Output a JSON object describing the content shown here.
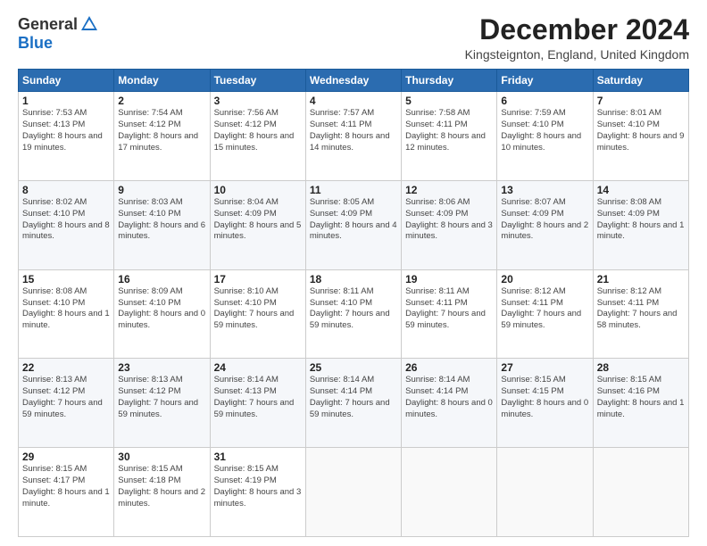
{
  "header": {
    "logo_general": "General",
    "logo_blue": "Blue",
    "title": "December 2024",
    "location": "Kingsteignton, England, United Kingdom"
  },
  "days_of_week": [
    "Sunday",
    "Monday",
    "Tuesday",
    "Wednesday",
    "Thursday",
    "Friday",
    "Saturday"
  ],
  "weeks": [
    [
      {
        "day": "1",
        "sunrise": "7:53 AM",
        "sunset": "4:13 PM",
        "daylight": "8 hours and 19 minutes."
      },
      {
        "day": "2",
        "sunrise": "7:54 AM",
        "sunset": "4:12 PM",
        "daylight": "8 hours and 17 minutes."
      },
      {
        "day": "3",
        "sunrise": "7:56 AM",
        "sunset": "4:12 PM",
        "daylight": "8 hours and 15 minutes."
      },
      {
        "day": "4",
        "sunrise": "7:57 AM",
        "sunset": "4:11 PM",
        "daylight": "8 hours and 14 minutes."
      },
      {
        "day": "5",
        "sunrise": "7:58 AM",
        "sunset": "4:11 PM",
        "daylight": "8 hours and 12 minutes."
      },
      {
        "day": "6",
        "sunrise": "7:59 AM",
        "sunset": "4:10 PM",
        "daylight": "8 hours and 10 minutes."
      },
      {
        "day": "7",
        "sunrise": "8:01 AM",
        "sunset": "4:10 PM",
        "daylight": "8 hours and 9 minutes."
      }
    ],
    [
      {
        "day": "8",
        "sunrise": "8:02 AM",
        "sunset": "4:10 PM",
        "daylight": "8 hours and 8 minutes."
      },
      {
        "day": "9",
        "sunrise": "8:03 AM",
        "sunset": "4:10 PM",
        "daylight": "8 hours and 6 minutes."
      },
      {
        "day": "10",
        "sunrise": "8:04 AM",
        "sunset": "4:09 PM",
        "daylight": "8 hours and 5 minutes."
      },
      {
        "day": "11",
        "sunrise": "8:05 AM",
        "sunset": "4:09 PM",
        "daylight": "8 hours and 4 minutes."
      },
      {
        "day": "12",
        "sunrise": "8:06 AM",
        "sunset": "4:09 PM",
        "daylight": "8 hours and 3 minutes."
      },
      {
        "day": "13",
        "sunrise": "8:07 AM",
        "sunset": "4:09 PM",
        "daylight": "8 hours and 2 minutes."
      },
      {
        "day": "14",
        "sunrise": "8:08 AM",
        "sunset": "4:09 PM",
        "daylight": "8 hours and 1 minute."
      }
    ],
    [
      {
        "day": "15",
        "sunrise": "8:08 AM",
        "sunset": "4:10 PM",
        "daylight": "8 hours and 1 minute."
      },
      {
        "day": "16",
        "sunrise": "8:09 AM",
        "sunset": "4:10 PM",
        "daylight": "8 hours and 0 minutes."
      },
      {
        "day": "17",
        "sunrise": "8:10 AM",
        "sunset": "4:10 PM",
        "daylight": "7 hours and 59 minutes."
      },
      {
        "day": "18",
        "sunrise": "8:11 AM",
        "sunset": "4:10 PM",
        "daylight": "7 hours and 59 minutes."
      },
      {
        "day": "19",
        "sunrise": "8:11 AM",
        "sunset": "4:11 PM",
        "daylight": "7 hours and 59 minutes."
      },
      {
        "day": "20",
        "sunrise": "8:12 AM",
        "sunset": "4:11 PM",
        "daylight": "7 hours and 59 minutes."
      },
      {
        "day": "21",
        "sunrise": "8:12 AM",
        "sunset": "4:11 PM",
        "daylight": "7 hours and 58 minutes."
      }
    ],
    [
      {
        "day": "22",
        "sunrise": "8:13 AM",
        "sunset": "4:12 PM",
        "daylight": "7 hours and 59 minutes."
      },
      {
        "day": "23",
        "sunrise": "8:13 AM",
        "sunset": "4:12 PM",
        "daylight": "7 hours and 59 minutes."
      },
      {
        "day": "24",
        "sunrise": "8:14 AM",
        "sunset": "4:13 PM",
        "daylight": "7 hours and 59 minutes."
      },
      {
        "day": "25",
        "sunrise": "8:14 AM",
        "sunset": "4:14 PM",
        "daylight": "7 hours and 59 minutes."
      },
      {
        "day": "26",
        "sunrise": "8:14 AM",
        "sunset": "4:14 PM",
        "daylight": "8 hours and 0 minutes."
      },
      {
        "day": "27",
        "sunrise": "8:15 AM",
        "sunset": "4:15 PM",
        "daylight": "8 hours and 0 minutes."
      },
      {
        "day": "28",
        "sunrise": "8:15 AM",
        "sunset": "4:16 PM",
        "daylight": "8 hours and 1 minute."
      }
    ],
    [
      {
        "day": "29",
        "sunrise": "8:15 AM",
        "sunset": "4:17 PM",
        "daylight": "8 hours and 1 minute."
      },
      {
        "day": "30",
        "sunrise": "8:15 AM",
        "sunset": "4:18 PM",
        "daylight": "8 hours and 2 minutes."
      },
      {
        "day": "31",
        "sunrise": "8:15 AM",
        "sunset": "4:19 PM",
        "daylight": "8 hours and 3 minutes."
      },
      null,
      null,
      null,
      null
    ]
  ],
  "labels": {
    "sunrise": "Sunrise:",
    "sunset": "Sunset:",
    "daylight": "Daylight:"
  }
}
